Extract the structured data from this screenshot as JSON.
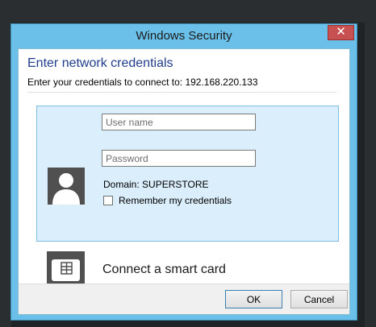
{
  "window": {
    "title": "Windows Security",
    "close_label": "✕"
  },
  "header": {
    "heading": "Enter network credentials",
    "subheading": "Enter your credentials to connect to: 192.168.220.133"
  },
  "credentials": {
    "username_placeholder": "User name",
    "username_value": "",
    "password_placeholder": "Password",
    "password_value": "",
    "domain_text": "Domain: SUPERSTORE",
    "remember_label": "Remember my credentials",
    "remember_checked": false
  },
  "smart_card": {
    "label": "Connect a smart card"
  },
  "buttons": {
    "ok_label": "OK",
    "cancel_label": "Cancel"
  },
  "colors": {
    "frame": "#6ac0e8",
    "close_button": "#c75050",
    "heading_text": "#1f3d8a",
    "panel_background": "#dbeefb",
    "panel_border": "#7ebde2"
  },
  "icons": {
    "user_tile": "user-avatar-icon",
    "smart_card": "smart-card-icon"
  }
}
